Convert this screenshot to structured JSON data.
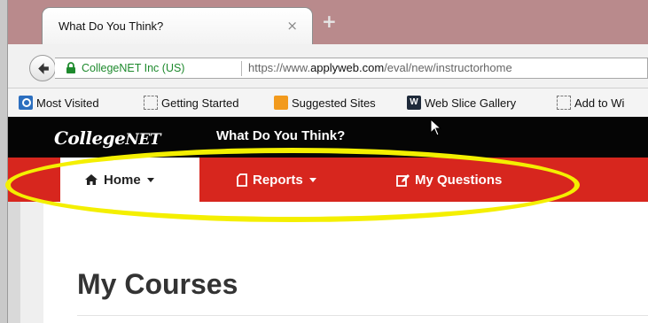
{
  "browser": {
    "tab_title": "What Do You Think?",
    "tab_close": "×",
    "new_tab": "+",
    "identity": "CollegeNET Inc (US)",
    "url_prefix": "https://www.",
    "url_domain": "applyweb.com",
    "url_path": "/eval/new/instructorhome"
  },
  "bookmarks": [
    {
      "label": "Most Visited",
      "icon": "ie-icon"
    },
    {
      "label": "Getting Started",
      "icon": "blank-page-icon"
    },
    {
      "label": "Suggested Sites",
      "icon": "suggested-sites-icon"
    },
    {
      "label": "Web Slice Gallery",
      "icon": "web-slice-icon"
    },
    {
      "label": "Add to Wi",
      "icon": "blank-page-icon"
    }
  ],
  "site": {
    "logo_a": "College",
    "logo_b": "NET",
    "title": "What Do You Think?"
  },
  "menu": {
    "home": "Home",
    "reports": "Reports",
    "questions": "My Questions"
  },
  "page": {
    "heading": "My Courses"
  },
  "colors": {
    "menu_red": "#d7261e",
    "highlight": "#f4ef00",
    "secure_green": "#1e8a2d"
  }
}
